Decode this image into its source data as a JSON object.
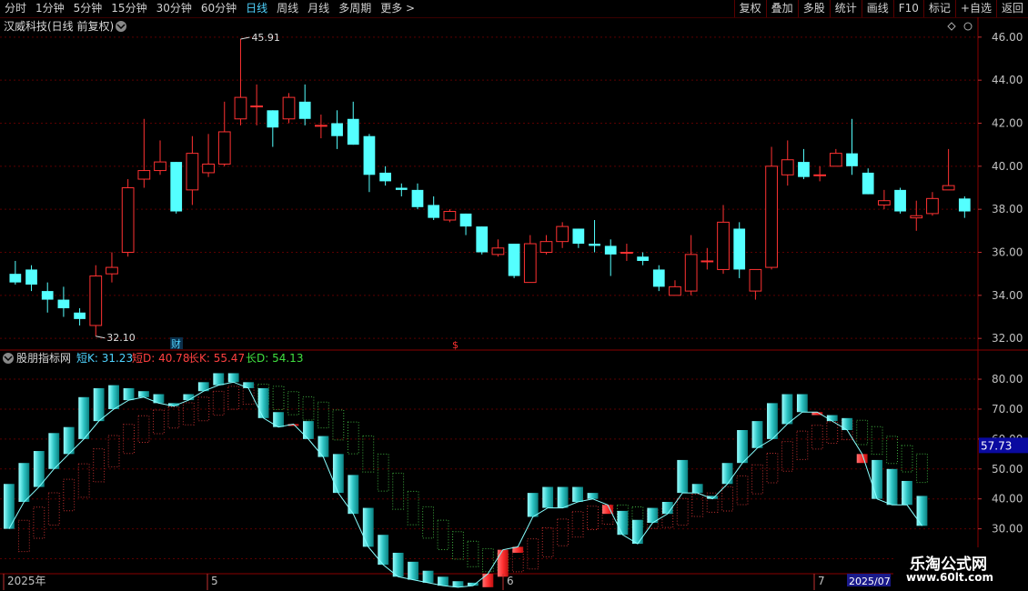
{
  "toolbar": {
    "left": [
      {
        "label": "分时",
        "active": false
      },
      {
        "label": "1分钟",
        "active": false
      },
      {
        "label": "5分钟",
        "active": false
      },
      {
        "label": "15分钟",
        "active": false
      },
      {
        "label": "30分钟",
        "active": false
      },
      {
        "label": "60分钟",
        "active": false
      },
      {
        "label": "日线",
        "active": true
      },
      {
        "label": "周线",
        "active": false
      },
      {
        "label": "月线",
        "active": false
      },
      {
        "label": "多周期",
        "active": false
      },
      {
        "label": "更多 >",
        "active": false
      }
    ],
    "right": [
      "复权",
      "叠加",
      "多股",
      "统计",
      "画线",
      "F10",
      "标记",
      "+自选",
      "返回"
    ]
  },
  "main_panel": {
    "title": "汉威科技(日线 前复权)",
    "high_label": "45.91",
    "low_label": "32.10",
    "marker_cai": "财",
    "marker_dollar": "$"
  },
  "indicator_panel": {
    "name": "股朋指标网",
    "short_k_label": "短K: 31.23",
    "short_d_label": "短D: 40.78",
    "long_k_label": "长K: 55.47",
    "long_d_label": "长D: 54.13",
    "current_value": "57.73"
  },
  "dates": {
    "labels": [
      "2025年",
      "5",
      "6",
      "7",
      "2025/07"
    ]
  },
  "watermark": {
    "title": "乐淘公式网",
    "url": "www.60lt.com"
  },
  "colors": {
    "up": "#ff3232",
    "down": "#54ffff",
    "grid": "#5a0000",
    "axis_text": "#c0c0c0",
    "long_up": "#c03030",
    "long_down": "#3fae3f"
  },
  "chart_data": [
    {
      "type": "candlestick",
      "title": "汉威科技(日线 前复权)",
      "ylim": [
        31.5,
        46.5
      ],
      "yticks": [
        32.0,
        34.0,
        36.0,
        38.0,
        40.0,
        42.0,
        44.0,
        46.0
      ],
      "candles": [
        [
          35.0,
          34.6,
          35.6,
          34.5
        ],
        [
          35.2,
          34.5,
          35.4,
          34.2
        ],
        [
          34.2,
          33.8,
          34.6,
          33.2
        ],
        [
          33.8,
          33.4,
          34.4,
          33.0
        ],
        [
          33.2,
          32.9,
          33.4,
          32.6
        ],
        [
          32.6,
          34.9,
          35.4,
          32.1
        ],
        [
          35.0,
          35.3,
          36.0,
          34.6
        ],
        [
          36.0,
          39.0,
          39.4,
          35.8
        ],
        [
          39.4,
          39.8,
          42.2,
          39.0
        ],
        [
          39.8,
          40.2,
          41.2,
          39.6
        ],
        [
          40.2,
          37.9,
          40.2,
          37.8
        ],
        [
          38.9,
          40.6,
          41.4,
          38.2
        ],
        [
          39.7,
          40.1,
          41.5,
          39.5
        ],
        [
          40.1,
          41.6,
          43.0,
          40.0
        ],
        [
          42.2,
          43.2,
          45.91,
          41.9
        ],
        [
          42.8,
          42.8,
          43.8,
          41.9
        ],
        [
          42.6,
          41.8,
          42.6,
          40.9
        ],
        [
          42.2,
          43.2,
          43.4,
          42.0
        ],
        [
          43.0,
          42.2,
          43.8,
          41.9
        ],
        [
          41.9,
          41.9,
          42.4,
          41.3
        ],
        [
          42.0,
          41.4,
          42.6,
          40.8
        ],
        [
          42.2,
          41.0,
          43.0,
          41.0
        ],
        [
          41.4,
          39.6,
          41.5,
          38.8
        ],
        [
          39.7,
          39.3,
          40.0,
          39.1
        ],
        [
          39.0,
          38.9,
          39.2,
          38.6
        ],
        [
          38.9,
          38.1,
          39.2,
          38.0
        ],
        [
          38.2,
          37.6,
          38.6,
          37.5
        ],
        [
          37.5,
          37.9,
          38.0,
          37.4
        ],
        [
          37.8,
          37.2,
          37.8,
          36.8
        ],
        [
          37.2,
          36.0,
          37.2,
          35.9
        ],
        [
          35.9,
          36.2,
          36.6,
          35.8
        ],
        [
          36.4,
          34.9,
          36.4,
          34.8
        ],
        [
          34.6,
          36.4,
          36.8,
          34.6
        ],
        [
          36.0,
          36.5,
          36.8,
          35.9
        ],
        [
          36.5,
          37.2,
          37.4,
          36.2
        ],
        [
          37.1,
          36.4,
          37.1,
          36.2
        ],
        [
          36.4,
          36.3,
          37.5,
          36.0
        ],
        [
          36.3,
          35.9,
          36.6,
          34.9
        ],
        [
          36.0,
          36.0,
          36.4,
          35.6
        ],
        [
          35.8,
          35.6,
          36.0,
          35.4
        ],
        [
          35.2,
          34.4,
          35.4,
          34.2
        ],
        [
          34.0,
          34.4,
          34.7,
          34.0
        ],
        [
          34.2,
          35.9,
          36.8,
          34.0
        ],
        [
          35.6,
          35.6,
          36.2,
          35.2
        ],
        [
          35.2,
          37.4,
          38.2,
          35.0
        ],
        [
          37.1,
          35.2,
          37.4,
          34.8
        ],
        [
          34.2,
          35.2,
          35.2,
          33.8
        ],
        [
          35.3,
          40.0,
          40.9,
          35.2
        ],
        [
          39.6,
          40.3,
          41.2,
          39.1
        ],
        [
          40.2,
          39.5,
          40.8,
          39.4
        ],
        [
          39.6,
          39.6,
          40.0,
          39.3
        ],
        [
          40.0,
          40.6,
          40.8,
          40.0
        ],
        [
          40.6,
          40.0,
          42.2,
          39.6
        ],
        [
          39.7,
          38.7,
          39.9,
          38.7
        ],
        [
          38.2,
          38.4,
          38.9,
          38.0
        ],
        [
          38.9,
          37.9,
          39.0,
          37.8
        ],
        [
          37.6,
          37.7,
          38.4,
          37.0
        ],
        [
          37.8,
          38.5,
          38.8,
          37.7
        ],
        [
          38.9,
          39.1,
          40.8,
          38.9
        ],
        [
          38.5,
          37.9,
          38.6,
          37.6
        ]
      ]
    },
    {
      "type": "bar",
      "title": "股朋指标网",
      "ylim": [
        15,
        87
      ],
      "yticks": [
        20.0,
        30.0,
        40.0,
        50.0,
        60.0,
        70.0,
        80.0
      ],
      "short_kd": [
        [
          30.0,
          45.0
        ],
        [
          39.0,
          52.0
        ],
        [
          44.0,
          56.0
        ],
        [
          50.0,
          62.0
        ],
        [
          55.0,
          64.0
        ],
        [
          60.0,
          74.0
        ],
        [
          66.0,
          77.0
        ],
        [
          70.0,
          78.0
        ],
        [
          73.0,
          77.0
        ],
        [
          74.0,
          76.0
        ],
        [
          72.0,
          75.0
        ],
        [
          71.0,
          72.0
        ],
        [
          73.0,
          75.0
        ],
        [
          76.0,
          79.0
        ],
        [
          78.0,
          82.0
        ],
        [
          79.0,
          82.0
        ],
        [
          77.0,
          79.0
        ],
        [
          67.0,
          77.0
        ],
        [
          64.0,
          69.0
        ],
        [
          65.0,
          65.0
        ],
        [
          60.0,
          66.0
        ],
        [
          54.0,
          61.0
        ],
        [
          42.0,
          55.0
        ],
        [
          35.0,
          48.0
        ],
        [
          24.0,
          37.0
        ],
        [
          18.0,
          28.0
        ],
        [
          14.0,
          22.0
        ],
        [
          13.0,
          19.0
        ],
        [
          12.0,
          16.0
        ],
        [
          11.0,
          14.0
        ],
        [
          10.5,
          12.5
        ],
        [
          11.0,
          12.0
        ],
        [
          15.0,
          10.5
        ],
        [
          23.0,
          14.0
        ],
        [
          24.0,
          22.0
        ],
        [
          34.0,
          42.0
        ],
        [
          37.0,
          44.0
        ],
        [
          37.0,
          44.0
        ],
        [
          39.0,
          44.0
        ],
        [
          40.0,
          42.0
        ],
        [
          38.0,
          35.0
        ],
        [
          28.0,
          36.0
        ],
        [
          25.0,
          33.0
        ],
        [
          32.0,
          37.0
        ],
        [
          35.0,
          39.0
        ],
        [
          42.0,
          53.0
        ],
        [
          42.0,
          45.0
        ],
        [
          40.0,
          41.0
        ],
        [
          45.0,
          52.0
        ],
        [
          52.0,
          63.0
        ],
        [
          57.0,
          66.0
        ],
        [
          60.0,
          72.0
        ],
        [
          65.0,
          75.0
        ],
        [
          69.0,
          75.0
        ],
        [
          69.0,
          68.0
        ],
        [
          66.0,
          68.0
        ],
        [
          63.0,
          67.0
        ],
        [
          55.0,
          52.0
        ],
        [
          40.0,
          53.0
        ],
        [
          38.0,
          50.0
        ],
        [
          38.0,
          46.0
        ],
        [
          31.0,
          41.0
        ]
      ],
      "long_kd_note": "long K/D shown as dotted boxes"
    }
  ]
}
